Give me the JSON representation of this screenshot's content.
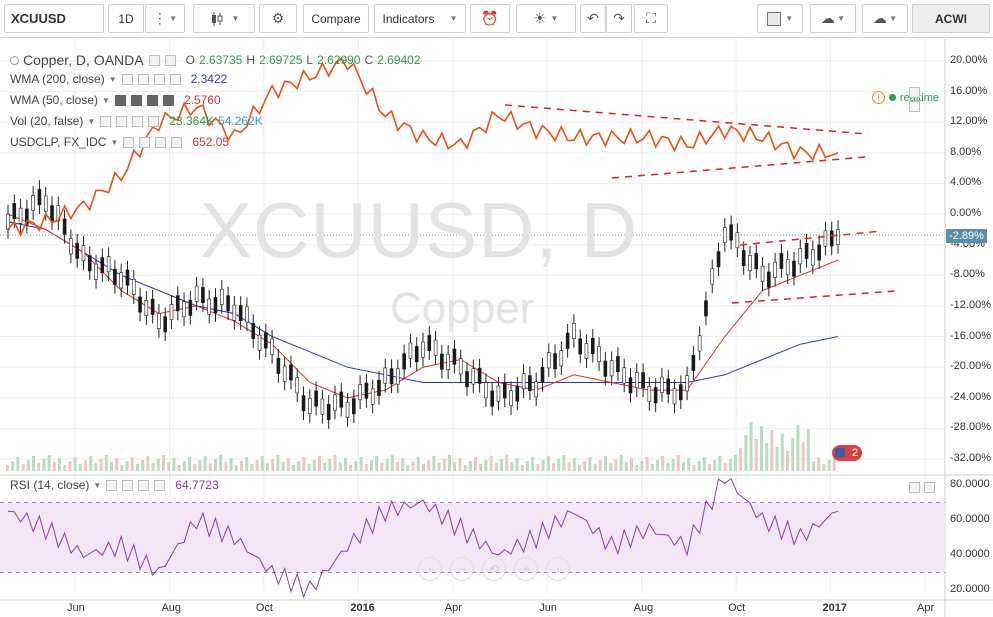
{
  "toolbar": {
    "symbol": "XCUUSD",
    "interval": "1D",
    "compare": "Compare",
    "indicators": "Indicators",
    "account": "ACWI"
  },
  "legend": {
    "main": {
      "name": "Copper, D, OANDA",
      "o_label": "O",
      "o": "2.63735",
      "h_label": "H",
      "h": "2.69725",
      "l_label": "L",
      "l": "2.62990",
      "c_label": "C",
      "c": "2.69402"
    },
    "studies": [
      {
        "name": "WMA (200, close)",
        "value": "2.3422",
        "color": "#2d35c8"
      },
      {
        "name": "WMA (50, close)",
        "value": "2.5760",
        "color": "#e03030"
      },
      {
        "name": "Vol (20, false)",
        "value": "23.364K",
        "value2": "54.262K",
        "color": "#2e9c44",
        "color2": "#3aa0d8"
      },
      {
        "name": "USDCLP, FX_IDC",
        "value": "652.05",
        "color": "#e03030"
      }
    ],
    "rsi": {
      "name": "RSI (14, close)",
      "value": "64.7723",
      "color": "#8a3fb0"
    }
  },
  "watermark": {
    "title": "XCUUSD, D",
    "subtitle": "Copper"
  },
  "realtime": "realtime",
  "price_axis": [
    "20.00%",
    "16.00%",
    "12.00%",
    "8.00%",
    "4.00%",
    "0.00%",
    "-4.00%",
    "-8.00%",
    "-12.00%",
    "-16.00%",
    "-20.00%",
    "-24.00%",
    "-28.00%",
    "-32.00%"
  ],
  "last_price_label": "-2.89%",
  "rsi_axis": [
    "80.0000",
    "60.0000",
    "40.0000",
    "20.0000"
  ],
  "time_axis": [
    "Jun",
    "Aug",
    "Oct",
    "2016",
    "Apr",
    "Jun",
    "Aug",
    "Oct",
    "2017",
    "Apr"
  ],
  "event_badge": "2",
  "chart_data": {
    "type": "line",
    "x": [
      "2015-04",
      "2015-05",
      "2015-06",
      "2015-07",
      "2015-08",
      "2015-09",
      "2015-10",
      "2015-11",
      "2015-12",
      "2016-01",
      "2016-02",
      "2016-03",
      "2016-04",
      "2016-05",
      "2016-06",
      "2016-07",
      "2016-08",
      "2016-09",
      "2016-10",
      "2016-11",
      "2016-12",
      "2017-01",
      "2017-02"
    ],
    "series": [
      {
        "name": "Copper, D, OANDA",
        "unit": "%",
        "values": [
          -1,
          2,
          -6,
          -8,
          -14,
          -11,
          -12,
          -18,
          -25,
          -25,
          -22,
          -17,
          -20,
          -24,
          -22,
          -16,
          -20,
          -23,
          -23,
          -2,
          -8,
          -6,
          -3
        ]
      },
      {
        "name": "USDCLP, FX_IDC",
        "unit": "%",
        "values": [
          -2,
          -1,
          1,
          5,
          12,
          14,
          10,
          16,
          18,
          20,
          13,
          10,
          9,
          13,
          11,
          10,
          10,
          10,
          9,
          11,
          10,
          8,
          8
        ]
      },
      {
        "name": "WMA (200, close)",
        "unit": "%",
        "values": [
          -1,
          -2,
          -5,
          -8,
          -10,
          -12,
          -13,
          -16,
          -18,
          -20,
          -21,
          -22,
          -22,
          -22,
          -22,
          -22,
          -22,
          -22,
          -22,
          -21,
          -19,
          -17,
          -16
        ]
      },
      {
        "name": "WMA (50, close)",
        "unit": "%",
        "values": [
          0,
          -2,
          -5,
          -10,
          -13,
          -12,
          -14,
          -17,
          -22,
          -24,
          -23,
          -20,
          -19,
          -22,
          -23,
          -21,
          -22,
          -23,
          -23,
          -16,
          -10,
          -8,
          -6
        ]
      }
    ],
    "rsi": {
      "name": "RSI (14, close)",
      "values": [
        65,
        55,
        40,
        45,
        30,
        60,
        50,
        30,
        20,
        45,
        65,
        70,
        55,
        40,
        50,
        65,
        45,
        55,
        45,
        85,
        60,
        50,
        65
      ],
      "ylim": [
        20,
        80
      ]
    },
    "ylim": [
      -32,
      20
    ],
    "grid": true,
    "legend_position": "top-left"
  }
}
